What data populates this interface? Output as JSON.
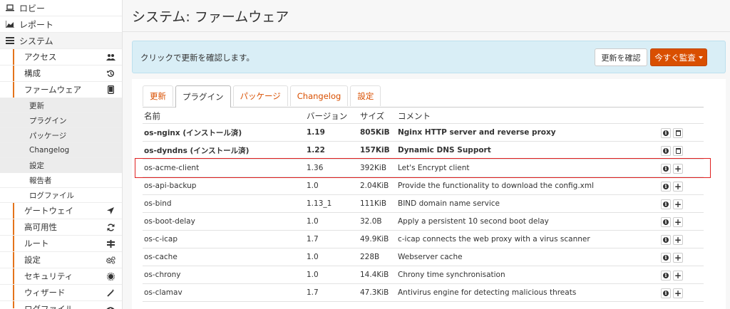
{
  "sidebar": {
    "top_items": [
      {
        "label": "ロビー",
        "icon": "laptop-icon"
      },
      {
        "label": "レポート",
        "icon": "area-chart-icon"
      },
      {
        "label": "システム",
        "icon": "list-icon"
      }
    ],
    "system_items": [
      {
        "label": "アクセス",
        "icon": "users-icon"
      },
      {
        "label": "構成",
        "icon": "history-icon"
      },
      {
        "label": "ファームウェア",
        "icon": "tablet-icon"
      }
    ],
    "firmware_sub": [
      "更新",
      "プラグイン",
      "パッケージ",
      "Changelog",
      "設定"
    ],
    "system_items_after": [
      "報告者",
      "ログファイル"
    ],
    "other_items": [
      {
        "label": "ゲートウェイ",
        "icon": "location-arrow-icon"
      },
      {
        "label": "高可用性",
        "icon": "refresh-icon"
      },
      {
        "label": "ルート",
        "icon": "signpost-icon"
      },
      {
        "label": "設定",
        "icon": "cogs-icon"
      },
      {
        "label": "セキュリティ",
        "icon": "certificate-icon"
      },
      {
        "label": "ウィザード",
        "icon": "magic-wand-icon"
      },
      {
        "label": "ログファイル",
        "icon": "eye-icon"
      }
    ]
  },
  "page": {
    "title": "システム: ファームウェア"
  },
  "alert": {
    "message": "クリックで更新を確認します。",
    "check_button": "更新を確認",
    "audit_button": "今すぐ監査"
  },
  "tabs": [
    "更新",
    "プラグイン",
    "パッケージ",
    "Changelog",
    "設定"
  ],
  "active_tab": 1,
  "table": {
    "headers": [
      "名前",
      "バージョン",
      "サイズ",
      "コメント"
    ],
    "rows": [
      {
        "name": "os-nginx (インストール済)",
        "version": "1.19",
        "size": "805KiB",
        "comment": "Nginx HTTP server and reverse proxy",
        "installed": true
      },
      {
        "name": "os-dyndns (インストール済)",
        "version": "1.22",
        "size": "157KiB",
        "comment": "Dynamic DNS Support",
        "installed": true
      },
      {
        "name": "os-acme-client",
        "version": "1.36",
        "size": "392KiB",
        "comment": "Let's Encrypt client",
        "installed": false
      },
      {
        "name": "os-api-backup",
        "version": "1.0",
        "size": "2.04KiB",
        "comment": "Provide the functionality to download the config.xml",
        "installed": false
      },
      {
        "name": "os-bind",
        "version": "1.13_1",
        "size": "111KiB",
        "comment": "BIND domain name service",
        "installed": false
      },
      {
        "name": "os-boot-delay",
        "version": "1.0",
        "size": "32.0B",
        "comment": "Apply a persistent 10 second boot delay",
        "installed": false
      },
      {
        "name": "os-c-icap",
        "version": "1.7",
        "size": "49.9KiB",
        "comment": "c-icap connects the web proxy with a virus scanner",
        "installed": false
      },
      {
        "name": "os-cache",
        "version": "1.0",
        "size": "228B",
        "comment": "Webserver cache",
        "installed": false
      },
      {
        "name": "os-chrony",
        "version": "1.0",
        "size": "14.4KiB",
        "comment": "Chrony time synchronisation",
        "installed": false
      },
      {
        "name": "os-clamav",
        "version": "1.7",
        "size": "47.3KiB",
        "comment": "Antivirus engine for detecting malicious threats",
        "installed": false
      }
    ]
  },
  "colors": {
    "accent": "#d94f00",
    "highlight_box": "#e02020",
    "alert_bg": "#d9eef6"
  }
}
